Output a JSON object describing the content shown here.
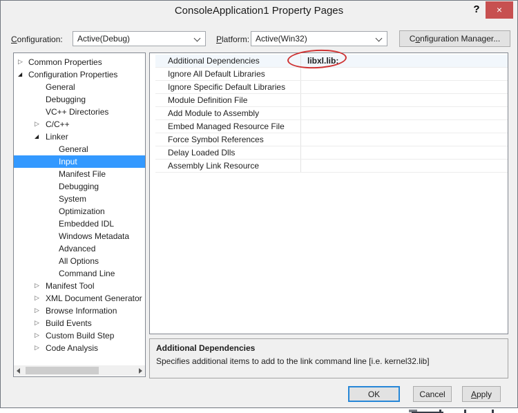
{
  "window": {
    "title": "ConsoleApplication1 Property Pages",
    "help_label": "?",
    "close_glyph": "×"
  },
  "toolbar": {
    "configuration_label": {
      "text": "Configuration:",
      "underline_index": 0
    },
    "configuration_value": "Active(Debug)",
    "platform_label": {
      "text": "Platform:",
      "underline_index": 0
    },
    "platform_value": "Active(Win32)",
    "config_manager_label": {
      "text": "Configuration Manager...",
      "underline_index": 1
    }
  },
  "tree": {
    "items": [
      {
        "label": "Common Properties",
        "level": 0,
        "state": "collapsed",
        "selected": false
      },
      {
        "label": "Configuration Properties",
        "level": 0,
        "state": "expanded",
        "selected": false
      },
      {
        "label": "General",
        "level": 1,
        "state": "none",
        "selected": false
      },
      {
        "label": "Debugging",
        "level": 1,
        "state": "none",
        "selected": false
      },
      {
        "label": "VC++ Directories",
        "level": 1,
        "state": "none",
        "selected": false
      },
      {
        "label": "C/C++",
        "level": 1,
        "state": "collapsed",
        "selected": false
      },
      {
        "label": "Linker",
        "level": 1,
        "state": "expanded",
        "selected": false
      },
      {
        "label": "General",
        "level": 2,
        "state": "none",
        "selected": false
      },
      {
        "label": "Input",
        "level": 2,
        "state": "none",
        "selected": true
      },
      {
        "label": "Manifest File",
        "level": 2,
        "state": "none",
        "selected": false
      },
      {
        "label": "Debugging",
        "level": 2,
        "state": "none",
        "selected": false
      },
      {
        "label": "System",
        "level": 2,
        "state": "none",
        "selected": false
      },
      {
        "label": "Optimization",
        "level": 2,
        "state": "none",
        "selected": false
      },
      {
        "label": "Embedded IDL",
        "level": 2,
        "state": "none",
        "selected": false
      },
      {
        "label": "Windows Metadata",
        "level": 2,
        "state": "none",
        "selected": false
      },
      {
        "label": "Advanced",
        "level": 2,
        "state": "none",
        "selected": false
      },
      {
        "label": "All Options",
        "level": 2,
        "state": "none",
        "selected": false
      },
      {
        "label": "Command Line",
        "level": 2,
        "state": "none",
        "selected": false
      },
      {
        "label": "Manifest Tool",
        "level": 1,
        "state": "collapsed",
        "selected": false
      },
      {
        "label": "XML Document Generator",
        "level": 1,
        "state": "collapsed",
        "selected": false
      },
      {
        "label": "Browse Information",
        "level": 1,
        "state": "collapsed",
        "selected": false
      },
      {
        "label": "Build Events",
        "level": 1,
        "state": "collapsed",
        "selected": false
      },
      {
        "label": "Custom Build Step",
        "level": 1,
        "state": "collapsed",
        "selected": false
      },
      {
        "label": "Code Analysis",
        "level": 1,
        "state": "collapsed",
        "selected": false
      }
    ]
  },
  "grid": {
    "rows": [
      {
        "name": "Additional Dependencies",
        "value": "libxl.lib;",
        "selected": true,
        "circled": true
      },
      {
        "name": "Ignore All Default Libraries",
        "value": "",
        "selected": false,
        "circled": false
      },
      {
        "name": "Ignore Specific Default Libraries",
        "value": "",
        "selected": false,
        "circled": false
      },
      {
        "name": "Module Definition File",
        "value": "",
        "selected": false,
        "circled": false
      },
      {
        "name": "Add Module to Assembly",
        "value": "",
        "selected": false,
        "circled": false
      },
      {
        "name": "Embed Managed Resource File",
        "value": "",
        "selected": false,
        "circled": false
      },
      {
        "name": "Force Symbol References",
        "value": "",
        "selected": false,
        "circled": false
      },
      {
        "name": "Delay Loaded Dlls",
        "value": "",
        "selected": false,
        "circled": false
      },
      {
        "name": "Assembly Link Resource",
        "value": "",
        "selected": false,
        "circled": false
      }
    ]
  },
  "description": {
    "title": "Additional Dependencies",
    "text": "Specifies additional items to add to the link command line [i.e. kernel32.lib]"
  },
  "buttons": {
    "ok": "OK",
    "cancel": "Cancel",
    "apply": {
      "text": "Apply",
      "underline_index": 0
    }
  },
  "colors": {
    "selection_blue": "#3399ff",
    "close_red": "#c75050",
    "annotation_red": "#cf3333",
    "default_button_border": "#2586d7",
    "dialog_background": "#f0f0f0"
  }
}
